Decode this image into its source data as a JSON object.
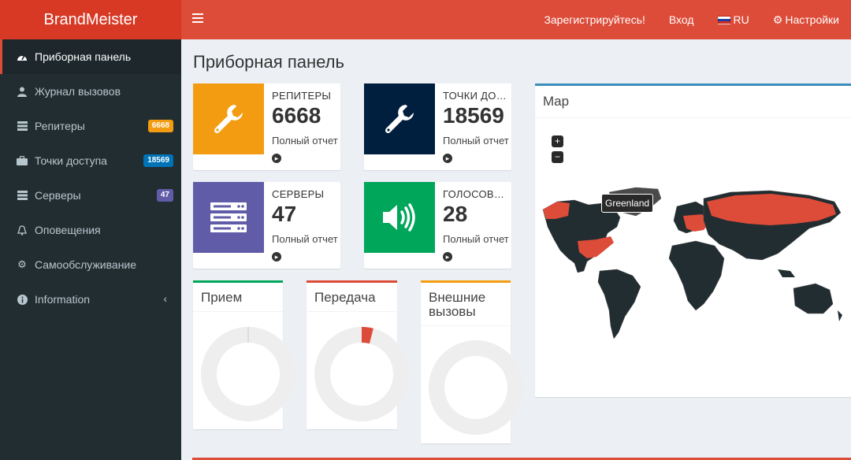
{
  "header": {
    "brand": "BrandMeister",
    "register": "Зарегистрируйтесь!",
    "login": "Вход",
    "language": "RU",
    "settings": "Настройки"
  },
  "sidebar": {
    "items": [
      {
        "label": "Приборная панель",
        "icon": "dashboard-icon"
      },
      {
        "label": "Журнал вызовов",
        "icon": "user-icon"
      },
      {
        "label": "Репитеры",
        "icon": "server-icon",
        "badge": "6668",
        "badge_color": "#f39c12"
      },
      {
        "label": "Точки доступа",
        "icon": "briefcase-icon",
        "badge": "18569",
        "badge_color": "#0073b7"
      },
      {
        "label": "Серверы",
        "icon": "server-icon",
        "badge": "47",
        "badge_color": "#605ca8"
      },
      {
        "label": "Оповещения",
        "icon": "bell-icon"
      },
      {
        "label": "Самообслуживание",
        "icon": "gear-icon"
      },
      {
        "label": "Information",
        "icon": "info-icon"
      }
    ]
  },
  "main": {
    "title": "Приборная панель",
    "info_boxes": [
      {
        "label": "РЕПИТЕРЫ",
        "value": "6668",
        "link": "Полный отчет",
        "color": "#f39c12",
        "icon": "wrench-icon"
      },
      {
        "label": "ТОЧКИ ДОСТУПА",
        "value": "18569",
        "link": "Полный отчет",
        "color": "#001f3f",
        "icon": "wrench-icon"
      },
      {
        "label": "СЕРВЕРЫ",
        "value": "47",
        "link": "Полный отчет",
        "color": "#605ca8",
        "icon": "server-rack-icon"
      },
      {
        "label": "ГОЛОСОВЫЕ",
        "value": "28",
        "link": "Полный отчет",
        "color": "#00a65a",
        "icon": "speaker-icon"
      }
    ],
    "donuts": [
      {
        "title": "Прием",
        "color": "#00a65a",
        "fill_fraction": 0.0
      },
      {
        "title": "Передача",
        "color": "#dd4b39",
        "fill_fraction": 0.04
      },
      {
        "title": "Внешние вызовы",
        "color": "#f39c12",
        "fill_fraction": 0.0
      }
    ],
    "map": {
      "title": "Map",
      "zoom_in": "+",
      "zoom_out": "−",
      "tooltip": "Greenland",
      "highlight_color": "#dd4b39",
      "land_color": "#222d32"
    }
  }
}
